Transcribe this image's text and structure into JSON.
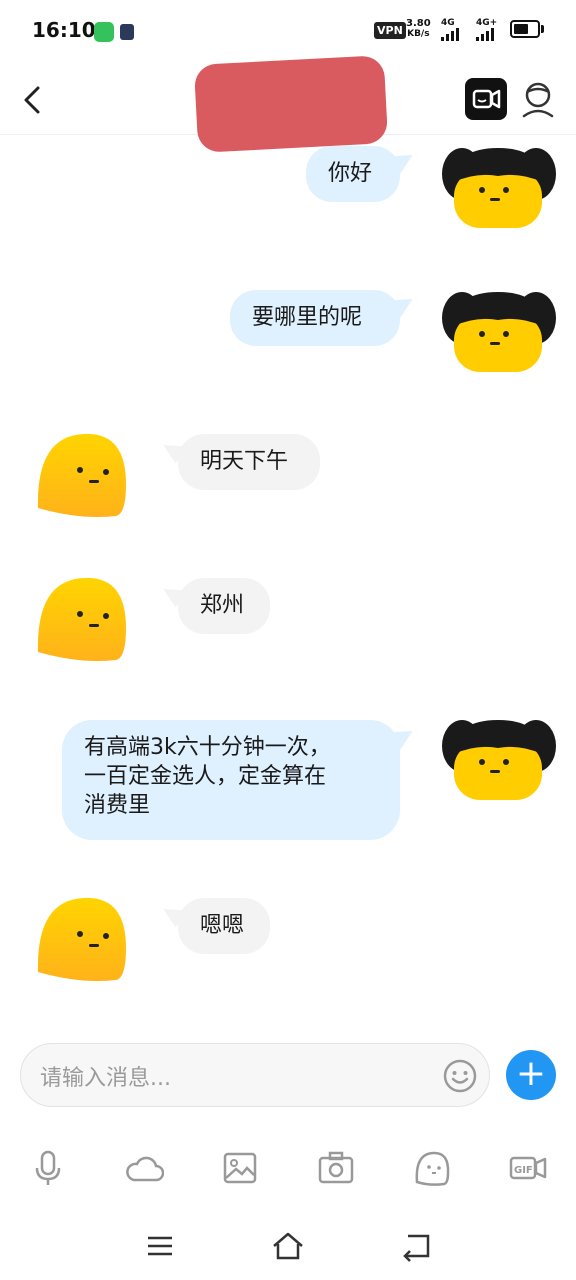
{
  "status": {
    "time": "16:10",
    "vpn": "VPN",
    "speed_value": "3.80",
    "speed_unit": "KB/s",
    "net1": "4G",
    "net2": "4G+"
  },
  "header": {
    "back": "back",
    "title_redacted": true
  },
  "messages": [
    {
      "side": "out",
      "text": "你好"
    },
    {
      "side": "out",
      "text": "要哪里的呢"
    },
    {
      "side": "in",
      "text": "明天下午"
    },
    {
      "side": "in",
      "text": "郑州"
    },
    {
      "side": "out",
      "text": "有高端3k六十分钟一次，\n一百定金选人，定金算在\n消费里"
    },
    {
      "side": "in",
      "text": "嗯嗯"
    }
  ],
  "composer": {
    "placeholder": "请输入消息...",
    "plus": "+"
  },
  "toolbar": [
    "mic-icon",
    "cloud-icon",
    "image-icon",
    "camera-icon",
    "sticker-icon",
    "gif-icon"
  ],
  "colors": {
    "outgoing_bubble": "#dff0ff",
    "incoming_bubble": "#f3f3f3",
    "accent": "#2196f3",
    "avatar_yellow": "#ffd400",
    "redaction": "#d95b60"
  }
}
